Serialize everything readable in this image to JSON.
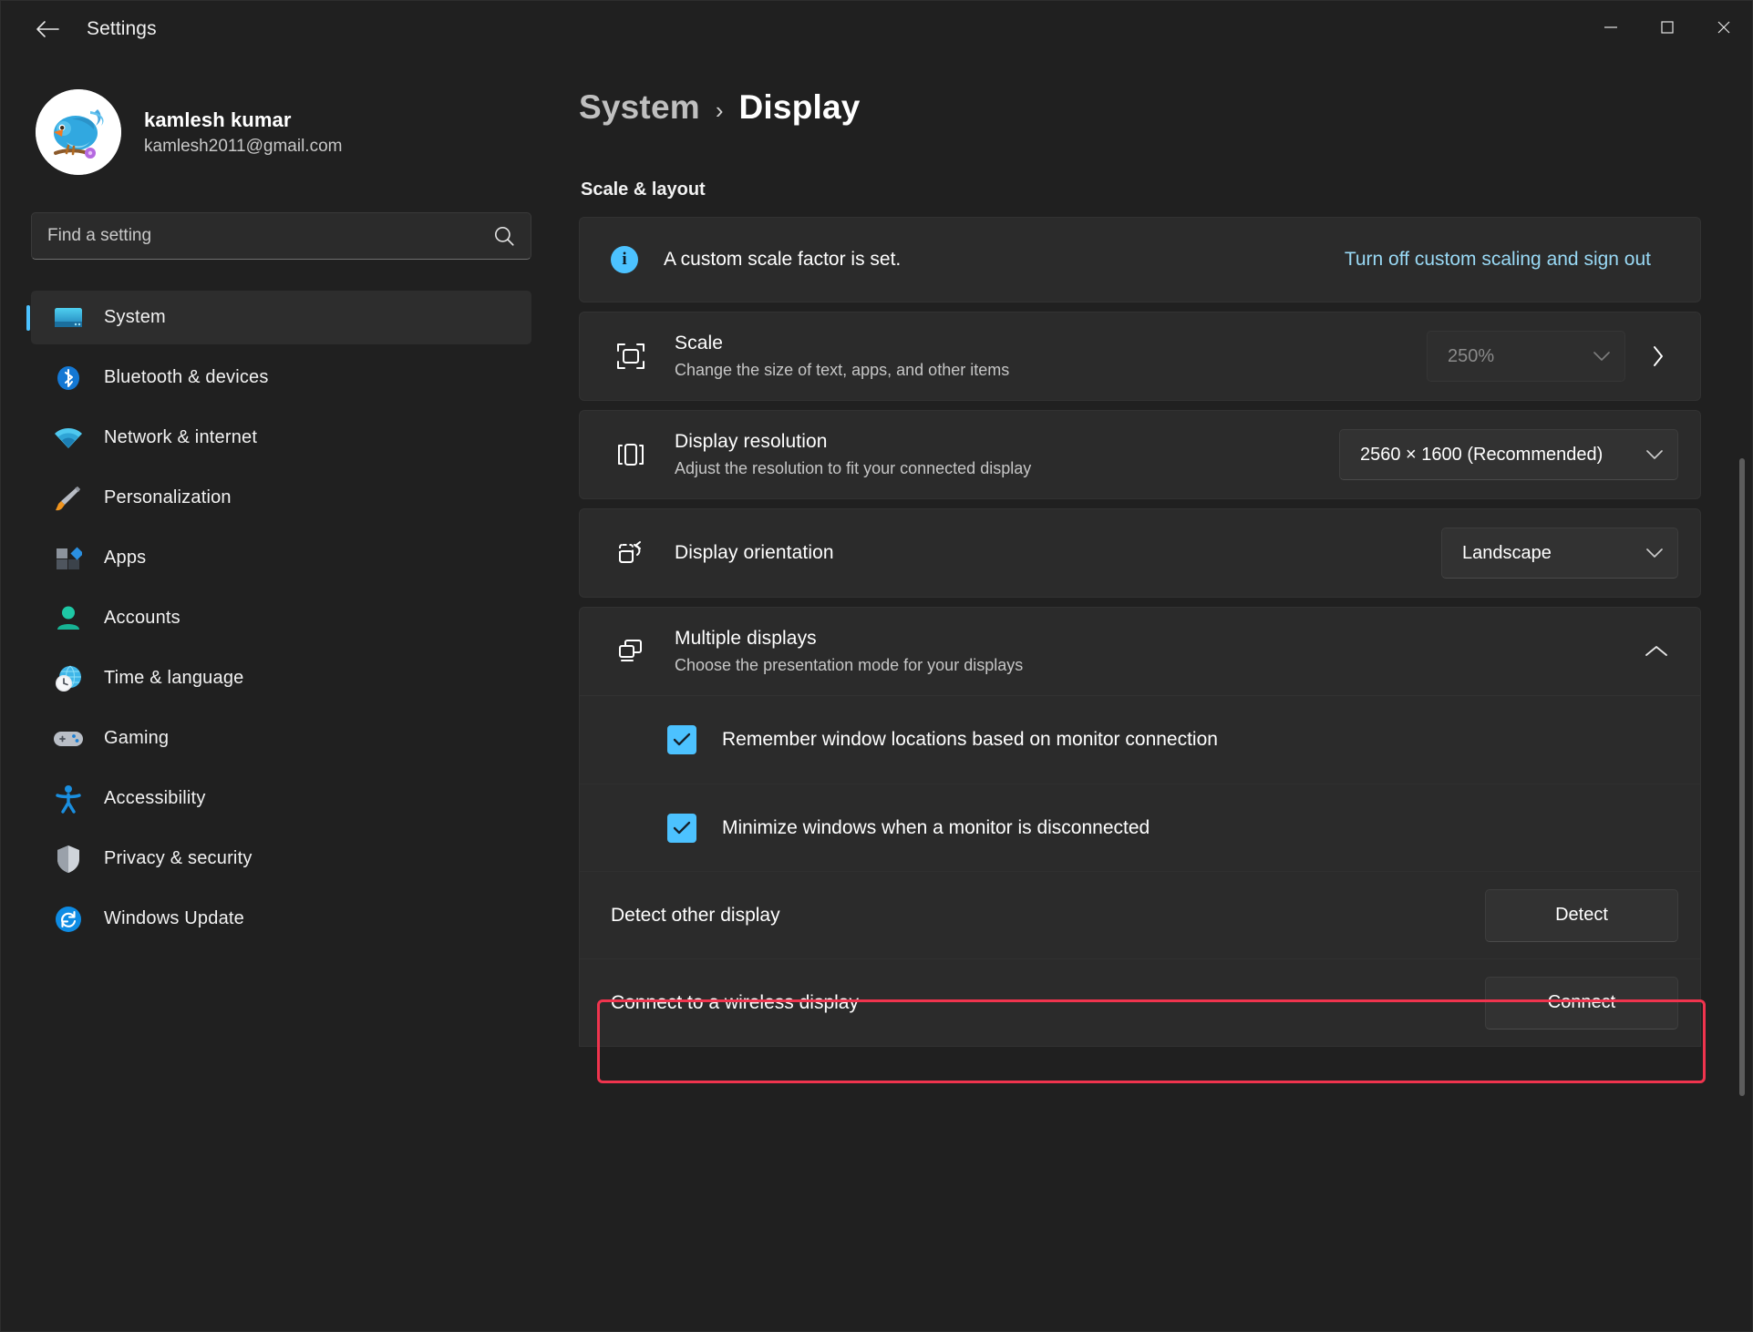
{
  "window": {
    "app_title": "Settings",
    "back_icon": "back-arrow-icon",
    "minimize_label": "─",
    "maximize_label": "□",
    "close_label": "✕"
  },
  "profile": {
    "name": "kamlesh kumar",
    "email": "kamlesh2011@gmail.com",
    "avatar_icon": "bird-avatar-icon"
  },
  "search": {
    "placeholder": "Find a setting",
    "value": "",
    "icon": "search-icon"
  },
  "sidebar": {
    "items": [
      {
        "label": "System",
        "icon": "monitor-icon",
        "active": true
      },
      {
        "label": "Bluetooth & devices",
        "icon": "bluetooth-icon",
        "active": false
      },
      {
        "label": "Network & internet",
        "icon": "wifi-icon",
        "active": false
      },
      {
        "label": "Personalization",
        "icon": "paintbrush-icon",
        "active": false
      },
      {
        "label": "Apps",
        "icon": "apps-icon",
        "active": false
      },
      {
        "label": "Accounts",
        "icon": "person-icon",
        "active": false
      },
      {
        "label": "Time & language",
        "icon": "clock-globe-icon",
        "active": false
      },
      {
        "label": "Gaming",
        "icon": "gamepad-icon",
        "active": false
      },
      {
        "label": "Accessibility",
        "icon": "accessibility-icon",
        "active": false
      },
      {
        "label": "Privacy & security",
        "icon": "shield-icon",
        "active": false
      },
      {
        "label": "Windows Update",
        "icon": "update-icon",
        "active": false
      }
    ]
  },
  "breadcrumb": {
    "parent": "System",
    "separator": "›",
    "current": "Display"
  },
  "main": {
    "section_title": "Scale & layout",
    "info_banner": {
      "icon": "info-icon",
      "glyph": "i",
      "text": "A custom scale factor is set.",
      "link": "Turn off custom scaling and sign out"
    },
    "scale_row": {
      "icon": "scale-icon",
      "title": "Scale",
      "subtitle": "Change the size of text, apps, and other items",
      "value": "250%",
      "disabled": true,
      "chevron_icon": "chevron-down-icon",
      "navigate_icon": "chevron-right-icon"
    },
    "resolution_row": {
      "icon": "resolution-icon",
      "title": "Display resolution",
      "subtitle": "Adjust the resolution to fit your connected display",
      "value": "2560 × 1600 (Recommended)",
      "chevron_icon": "chevron-down-icon"
    },
    "orientation_row": {
      "icon": "orientation-icon",
      "title": "Display orientation",
      "subtitle": "",
      "value": "Landscape",
      "chevron_icon": "chevron-down-icon"
    },
    "multiple_displays": {
      "icon": "multiple-displays-icon",
      "title": "Multiple displays",
      "subtitle": "Choose the presentation mode for your displays",
      "expanded": true,
      "expander_icon": "chevron-up-icon",
      "checkboxes": [
        {
          "label": "Remember window locations based on monitor connection",
          "checked": true,
          "highlighted": false
        },
        {
          "label": "Minimize windows when a monitor is disconnected",
          "checked": true,
          "highlighted": true
        }
      ],
      "actions": [
        {
          "label": "Detect other display",
          "button": "Detect"
        },
        {
          "label": "Connect to a wireless display",
          "button": "Connect"
        }
      ]
    }
  },
  "colors": {
    "accent": "#4cc2ff",
    "link": "#99d9f5",
    "highlight": "#f0344e",
    "window_bg": "#202020",
    "card_bg": "#2b2b2b"
  }
}
